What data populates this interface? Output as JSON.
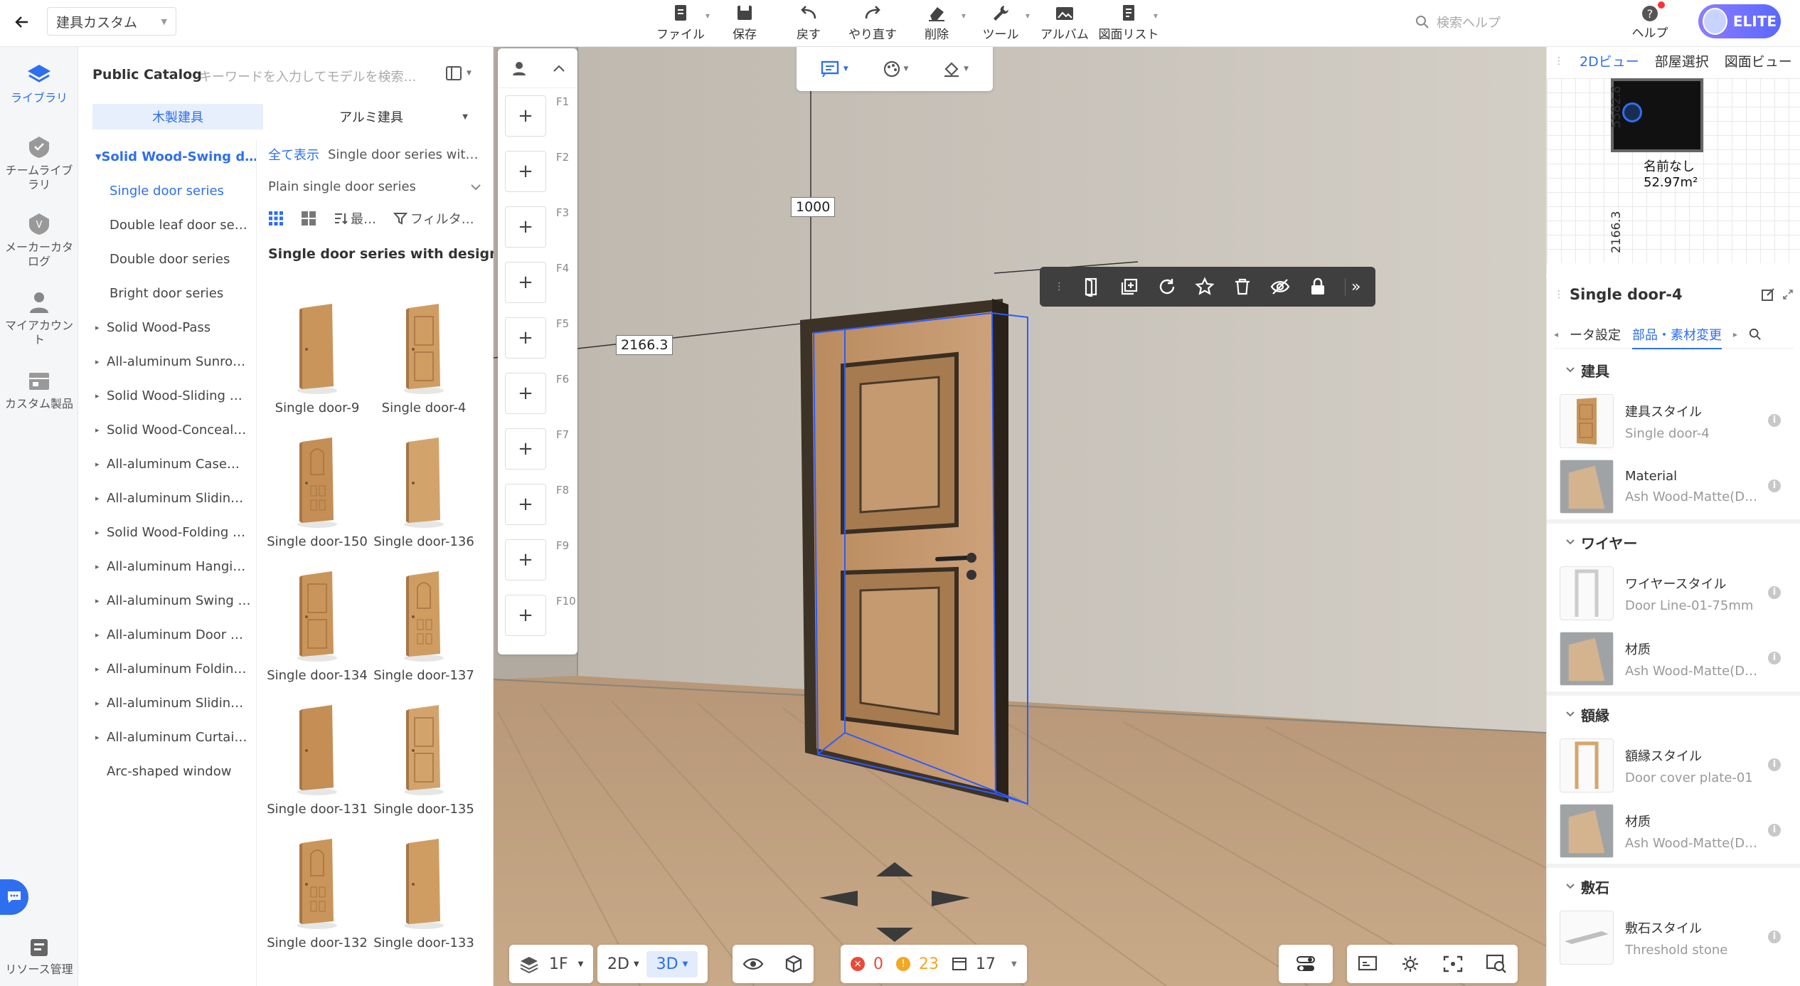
{
  "header": {
    "project_name": "建具カスタム",
    "toolbar": [
      {
        "label": "ファイル",
        "icon": "file-icon"
      },
      {
        "label": "保存",
        "icon": "save-icon"
      },
      {
        "label": "戻す",
        "icon": "undo-icon"
      },
      {
        "label": "やり直す",
        "icon": "redo-icon"
      },
      {
        "label": "削除",
        "icon": "eraser-icon"
      },
      {
        "label": "ツール",
        "icon": "wrench-icon"
      },
      {
        "label": "アルバム",
        "icon": "album-icon"
      },
      {
        "label": "図面リスト",
        "icon": "drawing-list-icon"
      }
    ],
    "search_help_placeholder": "検索ヘルプ",
    "help_label": "ヘルプ",
    "elite_label": "ELITE"
  },
  "rail": {
    "items": [
      {
        "label": "ライブラリ",
        "icon": "library-icon",
        "active": true
      },
      {
        "label": "チームライブラリ",
        "icon": "team-library-icon"
      },
      {
        "label": "メーカーカタログ",
        "icon": "maker-catalog-icon"
      },
      {
        "label": "マイアカウント",
        "icon": "account-icon"
      },
      {
        "label": "カスタム製品",
        "icon": "custom-products-icon"
      }
    ],
    "bottom_label": "リソース管理"
  },
  "catalog": {
    "title": "Public Catalog",
    "search_placeholder": "キーワードを入力してモデルを検索…",
    "tabs": [
      "木製建具",
      "アルミ建具"
    ],
    "tree": [
      {
        "label": "Solid Wood-Swing d…",
        "type": "expanded"
      },
      {
        "label": "Single door series",
        "type": "selected"
      },
      {
        "label": "Double leaf door se…",
        "type": "child"
      },
      {
        "label": "Double door series",
        "type": "child"
      },
      {
        "label": "Bright door series",
        "type": "child"
      },
      {
        "label": "Solid Wood-Pass",
        "type": "collapsed"
      },
      {
        "label": "All-aluminum Sunro…",
        "type": "collapsed"
      },
      {
        "label": "Solid Wood-Sliding …",
        "type": "collapsed"
      },
      {
        "label": "Solid Wood-Conceal…",
        "type": "collapsed"
      },
      {
        "label": "All-aluminum Case…",
        "type": "collapsed"
      },
      {
        "label": "All-aluminum Slidin…",
        "type": "collapsed"
      },
      {
        "label": "Solid Wood-Folding …",
        "type": "collapsed"
      },
      {
        "label": "All-aluminum Hangi…",
        "type": "collapsed"
      },
      {
        "label": "All-aluminum Swing …",
        "type": "collapsed"
      },
      {
        "label": "All-aluminum Door …",
        "type": "collapsed"
      },
      {
        "label": "All-aluminum Foldin…",
        "type": "collapsed"
      },
      {
        "label": "All-aluminum Slidin…",
        "type": "collapsed"
      },
      {
        "label": "All-aluminum Curtai…",
        "type": "collapsed"
      },
      {
        "label": "Arc-shaped window",
        "type": "plain"
      }
    ],
    "show_all": "全て表示",
    "breadcrumb_current": "Single door series wit…",
    "subcategory": "Plain single door series",
    "sort_label": "最…",
    "filter_label": "フィルタ…",
    "grid_heading": "Single door series with design…",
    "models": [
      "Single door-9",
      "Single door-4",
      "Single door-150",
      "Single door-136",
      "Single door-134",
      "Single door-137",
      "Single door-131",
      "Single door-135",
      "Single door-132",
      "Single door-133"
    ]
  },
  "viewport": {
    "floors": [
      "F1",
      "F2",
      "F3",
      "F4",
      "F5",
      "F6",
      "F7",
      "F8",
      "F9",
      "F10"
    ],
    "dim_top": "1000",
    "dim_left": "2166.3",
    "bottom": {
      "floor": "1F",
      "mode_2d": "2D",
      "mode_3d": "3D",
      "errors": "0",
      "warnings": "23",
      "items": "17"
    }
  },
  "minimap": {
    "tabs": [
      "2Dビュー",
      "部屋選択",
      "図面ビュー"
    ],
    "room_name": "名前なし",
    "room_area": "52.97m²",
    "dim_vertical": "5582.8",
    "dim_bottom": "2166.3"
  },
  "props": {
    "title": "Single door-4",
    "tabs": [
      "ータ設定",
      "部品・素材変更"
    ],
    "sections": [
      {
        "title": "建具",
        "items": [
          {
            "name": "建具スタイル",
            "value": "Single door-4",
            "thumb": "door"
          },
          {
            "name": "Material",
            "value": "Ash Wood-Matte(Def…",
            "thumb": "material"
          }
        ]
      },
      {
        "title": "ワイヤー",
        "items": [
          {
            "name": "ワイヤースタイル",
            "value": "Door Line-01-75mm",
            "thumb": "frame"
          },
          {
            "name": "材质",
            "value": "Ash Wood-Matte(Def…",
            "thumb": "material"
          }
        ]
      },
      {
        "title": "額縁",
        "items": [
          {
            "name": "額縁スタイル",
            "value": "Door cover plate-01",
            "thumb": "cover"
          },
          {
            "name": "材质",
            "value": "Ash Wood-Matte(Def…",
            "thumb": "material"
          }
        ]
      },
      {
        "title": "敷石",
        "items": [
          {
            "name": "敷石スタイル",
            "value": "Threshold stone",
            "thumb": "stone"
          }
        ]
      }
    ]
  },
  "colors": {
    "accent": "#2e6ff0",
    "wood": "#c9955a",
    "selection": "#2a5cff"
  }
}
